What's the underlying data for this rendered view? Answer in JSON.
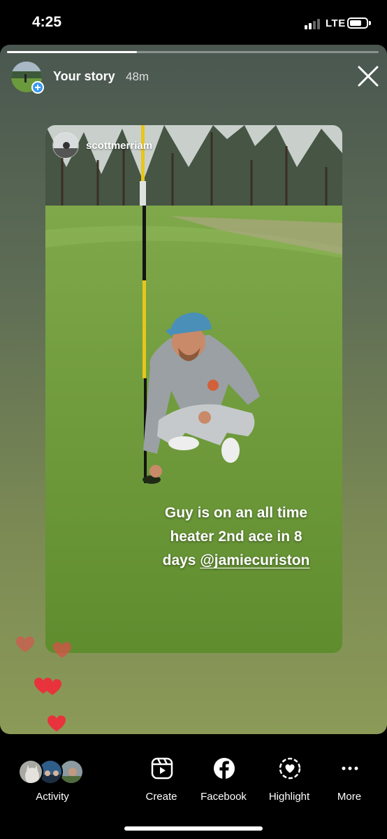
{
  "status_bar": {
    "time": "4:25",
    "network": "LTE",
    "signal_bars_filled": 2,
    "signal_bars_total": 4
  },
  "story": {
    "owner_label": "Your story",
    "time_ago": "48m",
    "progress": 0.35,
    "add_badge_icon": "plus-icon",
    "close_icon": "close-icon",
    "reposted": {
      "username": "scottmerriam",
      "caption_lines": [
        "Guy is on an all time",
        "heater 2nd ace in 8",
        "days "
      ],
      "mention": "@jamiecuriston"
    },
    "reaction_icon": "heart-icon",
    "reaction_color": "#e8323c"
  },
  "bottom_bar": {
    "activity_label": "Activity",
    "actions": [
      {
        "label": "Create",
        "icon": "reels-create-icon"
      },
      {
        "label": "Facebook",
        "icon": "facebook-icon"
      },
      {
        "label": "Highlight",
        "icon": "highlight-heart-icon"
      },
      {
        "label": "More",
        "icon": "more-dots-icon"
      }
    ]
  }
}
